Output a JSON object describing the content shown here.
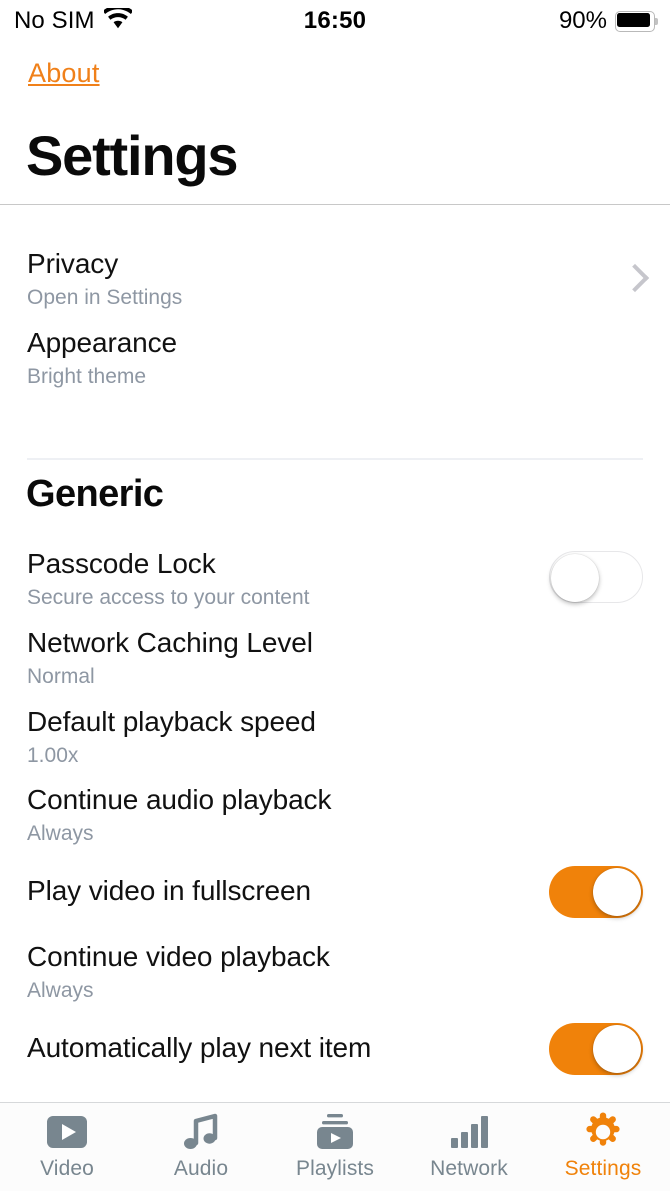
{
  "status_bar": {
    "carrier": "No SIM",
    "wifi_icon": "wifi-icon",
    "time": "16:50",
    "battery_percent": "90%",
    "battery_icon": "battery-icon"
  },
  "header": {
    "back_label": "About",
    "title": "Settings"
  },
  "colors": {
    "accent": "#F0820A",
    "title": "#0A0A0A",
    "subtitle": "#8E97A3",
    "tab_inactive": "#78868F",
    "separator": "#C8C8C8"
  },
  "sections": [
    {
      "header": null,
      "rows": [
        {
          "title": "Privacy",
          "subtitle": "Open in Settings",
          "accessory": "chevron"
        },
        {
          "title": "Appearance",
          "subtitle": "Bright theme",
          "accessory": "none"
        }
      ]
    },
    {
      "header": "Generic",
      "rows": [
        {
          "title": "Passcode Lock",
          "subtitle": "Secure access to your content",
          "accessory": "toggle",
          "toggle_on": false
        },
        {
          "title": "Network Caching Level",
          "subtitle": "Normal",
          "accessory": "none"
        },
        {
          "title": "Default playback speed",
          "subtitle": "1.00x",
          "accessory": "none"
        },
        {
          "title": "Continue audio playback",
          "subtitle": "Always",
          "accessory": "none"
        },
        {
          "title": "Play video in fullscreen",
          "subtitle": null,
          "accessory": "toggle",
          "toggle_on": true
        },
        {
          "title": "Continue video playback",
          "subtitle": "Always",
          "accessory": "none"
        },
        {
          "title": "Automatically play next item",
          "subtitle": null,
          "accessory": "toggle",
          "toggle_on": true
        }
      ]
    }
  ],
  "tabbar": {
    "items": [
      {
        "label": "Video",
        "icon": "video-play-icon",
        "active": false
      },
      {
        "label": "Audio",
        "icon": "music-note-icon",
        "active": false
      },
      {
        "label": "Playlists",
        "icon": "playlist-stack-icon",
        "active": false
      },
      {
        "label": "Network",
        "icon": "signal-bars-icon",
        "active": false
      },
      {
        "label": "Settings",
        "icon": "gear-icon",
        "active": true
      }
    ]
  }
}
